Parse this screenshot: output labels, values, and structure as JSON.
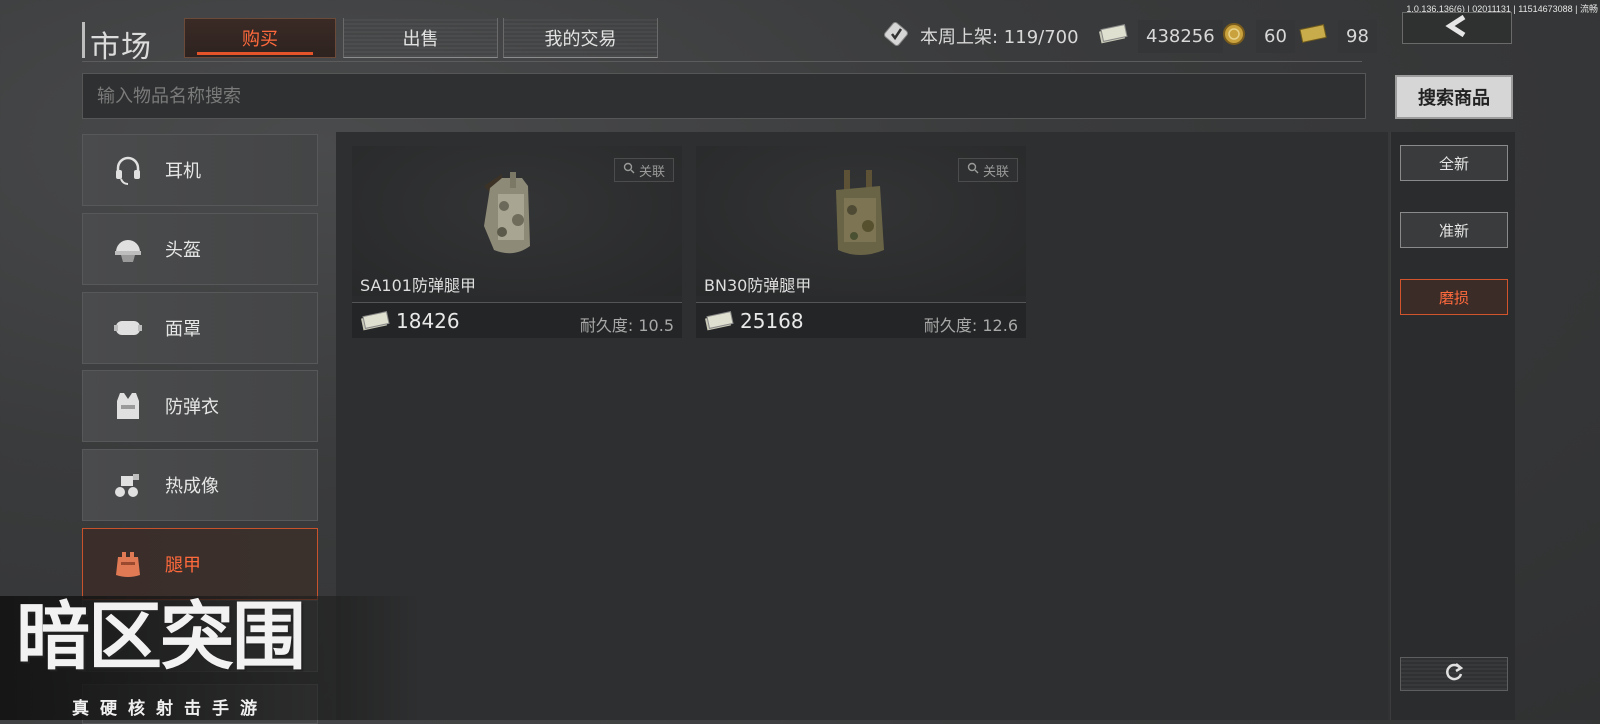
{
  "version": "1.0.136.136(6) | 02011131 | 11514673088 | 流畅",
  "header": {
    "title": "市场",
    "tabs": [
      {
        "label": "购买",
        "active": true
      },
      {
        "label": "出售",
        "active": false
      },
      {
        "label": "我的交易",
        "active": false
      }
    ],
    "weekly_listing_label": "本周上架: 119/700",
    "cash": "438256",
    "coins": "60",
    "bills": "98"
  },
  "search": {
    "placeholder": "输入物品名称搜索",
    "button_label": "搜索商品"
  },
  "categories": [
    {
      "label": "耳机",
      "icon": "headset-icon",
      "active": false
    },
    {
      "label": "头盔",
      "icon": "helmet-icon",
      "active": false
    },
    {
      "label": "面罩",
      "icon": "mask-icon",
      "active": false
    },
    {
      "label": "防弹衣",
      "icon": "vest-icon",
      "active": false
    },
    {
      "label": "热成像",
      "icon": "thermal-icon",
      "active": false
    },
    {
      "label": "腿甲",
      "icon": "leg-armor-icon",
      "active": true
    }
  ],
  "items": [
    {
      "name": "SA101防弹腿甲",
      "price": "18426",
      "durability": "耐久度: 10.5",
      "assoc_label": "关联"
    },
    {
      "name": "BN30防弹腿甲",
      "price": "25168",
      "durability": "耐久度: 12.6",
      "assoc_label": "关联"
    }
  ],
  "filters": [
    {
      "label": "全新",
      "active": false
    },
    {
      "label": "准新",
      "active": false
    },
    {
      "label": "磨损",
      "active": true
    }
  ],
  "logo": {
    "title": "暗区突围",
    "subtitle": "真硬核射击手游"
  },
  "colors": {
    "accent": "#ff6a3c",
    "background": "#3a3b3c"
  }
}
